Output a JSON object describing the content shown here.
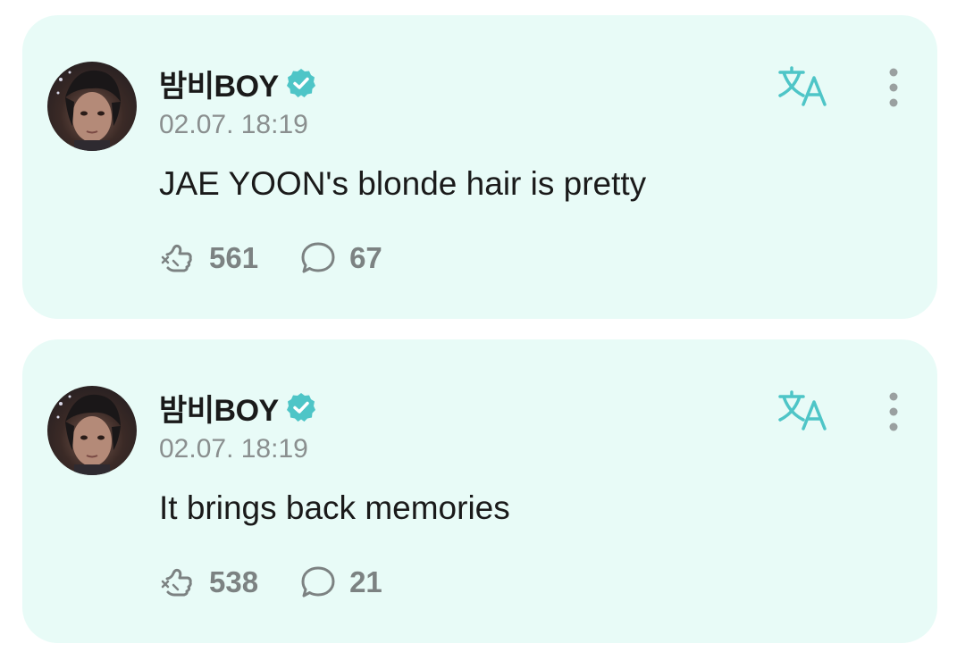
{
  "colors": {
    "card_background": "#e8fbf7",
    "accent": "#4ec5c7",
    "text_primary": "#1a1a1a",
    "text_secondary": "#8a8f8f",
    "icon_gray": "#7c8282"
  },
  "posts": [
    {
      "author": "밤비BOY",
      "verified": true,
      "timestamp": "02.07. 18:19",
      "text": "JAE YOON's blonde hair is pretty",
      "likes": "561",
      "comments": "67",
      "icons": {
        "translate": "translate-icon",
        "more": "more-vertical-icon",
        "like": "like-icon",
        "comment": "comment-icon"
      }
    },
    {
      "author": "밤비BOY",
      "verified": true,
      "timestamp": "02.07. 18:19",
      "text": "It brings back memories",
      "likes": "538",
      "comments": "21",
      "icons": {
        "translate": "translate-icon",
        "more": "more-vertical-icon",
        "like": "like-icon",
        "comment": "comment-icon"
      }
    }
  ]
}
